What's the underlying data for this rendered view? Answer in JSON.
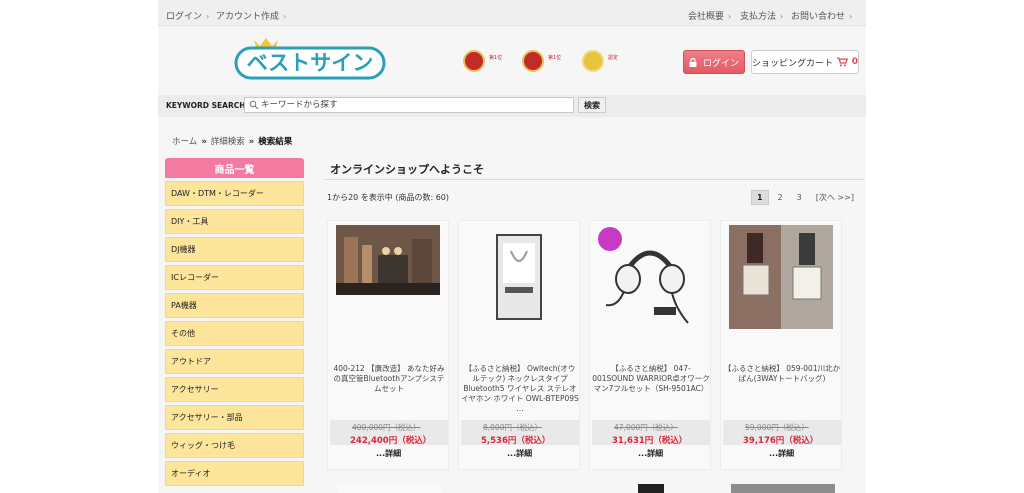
{
  "topbar": {
    "left_links": [
      "ログイン",
      "アカウント作成"
    ],
    "right_links": [
      "会社概要",
      "支払方法",
      "お問い合わせ"
    ]
  },
  "brand": {
    "logo_text": "ベストサイン",
    "accent": "#2a9fb8"
  },
  "header": {
    "login_label": "ログイン",
    "cart_label": "ショッピングカート",
    "cart_count": "0",
    "awards": [
      "第1位",
      "第1位",
      "認定"
    ]
  },
  "search": {
    "label": "KEYWORD SEARCH",
    "placeholder": "キーワードから探す",
    "button": "検索"
  },
  "breadcrumb": [
    "ホーム",
    "詳細検索",
    "検索結果"
  ],
  "sidebar": {
    "title": "商品一覧",
    "categories": [
      "DAW・DTM・レコーダー",
      "DIY・工具",
      "DJ機器",
      "ICレコーダー",
      "PA機器",
      "その他",
      "アウトドア",
      "アクセサリー",
      "アクセサリー・部品",
      "ウィッグ・つけ毛",
      "オーディオ"
    ]
  },
  "main": {
    "title": "オンラインショップへようこそ",
    "count_text": "1から20 を表示中 (商品の数: 60)",
    "pager": [
      "1",
      "2",
      "3",
      "[次へ >>]"
    ],
    "detail_label": "...詳細",
    "products": [
      {
        "name": "400-212 【廣改造】 あなた好みの真空管Bluetoothアンプシステムセット",
        "old_price": "400,000円（税込）",
        "price": "242,400円（税込）"
      },
      {
        "name": "【ふるさと納税】 Owltech(オウルテック) ネックレスタイプ Bluetooth5 ワイヤレス ステレオイヤホン ホワイト OWL-BTEP09S …",
        "old_price": "8,000円（税込）",
        "price": "5,536円（税込）"
      },
      {
        "name": "【ふるさと納税】 047-001SOUND WARRIOR卓オワークマン7フルセット（SH-9501AC）",
        "old_price": "47,000円（税込）",
        "price": "31,631円（税込）"
      },
      {
        "name": "【ふるさと納税】 059-001川北かばん(3WAYトートバッグ)",
        "old_price": "59,000円（税込）",
        "price": "39,176円（税込）"
      }
    ]
  },
  "colors": {
    "pink": "#f37aa1",
    "yellow": "#fde69b",
    "price_red": "#d8283c",
    "login_red": "#e35a64"
  }
}
